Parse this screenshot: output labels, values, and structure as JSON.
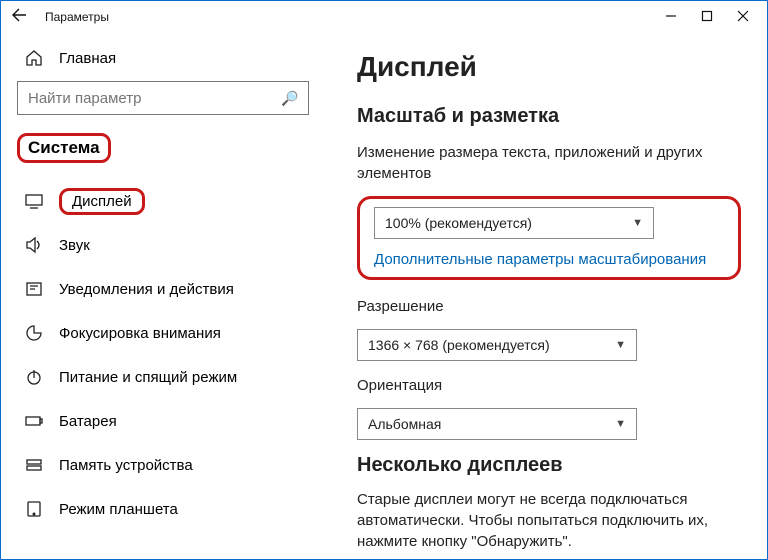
{
  "window": {
    "title": "Параметры"
  },
  "sidebar": {
    "home_label": "Главная",
    "search_placeholder": "Найти параметр",
    "section_title": "Система",
    "items": [
      {
        "label": "Дисплей"
      },
      {
        "label": "Звук"
      },
      {
        "label": "Уведомления и действия"
      },
      {
        "label": "Фокусировка внимания"
      },
      {
        "label": "Питание и спящий режим"
      },
      {
        "label": "Батарея"
      },
      {
        "label": "Память устройства"
      },
      {
        "label": "Режим планшета"
      }
    ]
  },
  "content": {
    "page_title": "Дисплей",
    "section_scale_title": "Масштаб и разметка",
    "scale_desc": "Изменение размера текста, приложений и других элементов",
    "scale_value": "100% (рекомендуется)",
    "advanced_link": "Дополнительные параметры масштабирования",
    "resolution_label": "Разрешение",
    "resolution_value": "1366 × 768 (рекомендуется)",
    "orientation_label": "Ориентация",
    "orientation_value": "Альбомная",
    "multi_title": "Несколько дисплеев",
    "multi_desc": "Старые дисплеи могут не всегда подключаться автоматически. Чтобы попытаться подключить их, нажмите кнопку \"Обнаружить\"."
  }
}
